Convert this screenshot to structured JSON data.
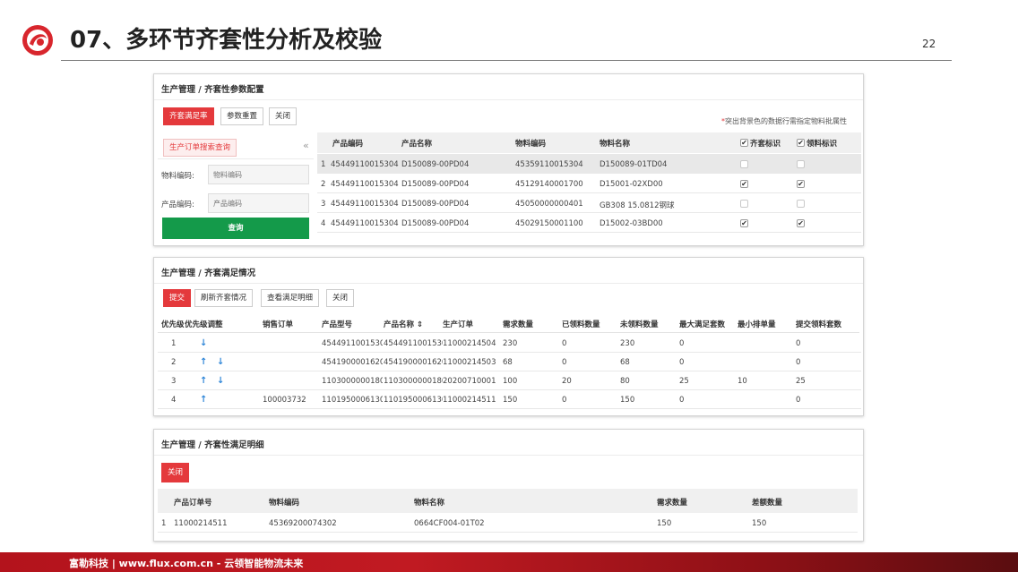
{
  "slide": {
    "title": "07、多环节齐套性分析及校验",
    "page": "22",
    "footer": "富勒科技 | www.flux.com.cn - 云领智能物流未来"
  },
  "colors": {
    "accent_red": "#e4393c",
    "query_green": "#149a4a",
    "arrow_blue": "#2f86d8"
  },
  "panel1": {
    "title": "生产管理 / 齐套性参数配置",
    "buttons": [
      "齐套满足率",
      "参数重置",
      "关闭"
    ],
    "note_star": "*",
    "note": "突出背景色的数据行需指定物料批属性",
    "search_tab": "生产订单搜索查询",
    "collapse": "«",
    "material_label": "物料编码:",
    "material_placeholder": "物料编码",
    "product_label": "产品编码:",
    "product_placeholder": "产品编码",
    "query_btn": "查询",
    "columns": [
      "产品编码",
      "产品名称",
      "物料编码",
      "物料名称",
      "齐套标识",
      "领料标识"
    ],
    "rows": [
      {
        "n": "1",
        "pcode": "45449110015304",
        "pname": "D150089-00PD04",
        "mcode": "45359110015304",
        "mname": "D150089-01TD04",
        "kit": false,
        "pick": false,
        "hl": true
      },
      {
        "n": "2",
        "pcode": "45449110015304",
        "pname": "D150089-00PD04",
        "mcode": "45129140001700",
        "mname": "D15001-02XD00",
        "kit": true,
        "pick": true,
        "hl": false
      },
      {
        "n": "3",
        "pcode": "45449110015304",
        "pname": "D150089-00PD04",
        "mcode": "45050000000401",
        "mname": "GB308 15.0812钢球",
        "kit": false,
        "pick": false,
        "hl": false
      },
      {
        "n": "4",
        "pcode": "45449110015304",
        "pname": "D150089-00PD04",
        "mcode": "45029150001100",
        "mname": "D15002-03BD00",
        "kit": true,
        "pick": true,
        "hl": false
      }
    ]
  },
  "panel2": {
    "title": "生产管理 / 齐套满足情况",
    "buttons": [
      "提交",
      "刷新齐套情况",
      "查看满足明细",
      "关闭"
    ],
    "columns": [
      "优先级",
      "优先级调整",
      "销售订单",
      "产品型号",
      "产品名称 ⇕",
      "生产订单",
      "需求数量",
      "已领料数量",
      "未领料数量",
      "最大满足套数",
      "最小排单量",
      "提交领料套数"
    ],
    "rows": [
      {
        "pri": "1",
        "up": false,
        "down": true,
        "so": "",
        "model": "4544911001530:",
        "name": "4544911001530:",
        "po": "11000214504",
        "req": "230",
        "picked": "0",
        "unpicked": "230",
        "max": "0",
        "min": "",
        "submit": "0"
      },
      {
        "pri": "2",
        "up": true,
        "down": true,
        "so": "",
        "model": "4541900001620:",
        "name": "4541900001620:",
        "po": "11000214503",
        "req": "68",
        "picked": "0",
        "unpicked": "68",
        "max": "0",
        "min": "",
        "submit": "0"
      },
      {
        "pri": "3",
        "up": true,
        "down": true,
        "so": "",
        "model": "1103000000180(",
        "name": "1103000000180(",
        "po": "20200710001",
        "req": "100",
        "picked": "20",
        "unpicked": "80",
        "max": "25",
        "min": "10",
        "submit": "25"
      },
      {
        "pri": "4",
        "up": true,
        "down": false,
        "so": "100003732",
        "model": "1101950006130(",
        "name": "1101950006130(",
        "po": "11000214511",
        "req": "150",
        "picked": "0",
        "unpicked": "150",
        "max": "0",
        "min": "",
        "submit": "0"
      }
    ]
  },
  "panel3": {
    "title": "生产管理 / 齐套性满足明细",
    "button": "关闭",
    "columns": [
      "产品订单号",
      "物料编码",
      "物料名称",
      "需求数量",
      "差额数量"
    ],
    "rows": [
      {
        "n": "1",
        "order": "11000214511",
        "mcode": "45369200074302",
        "mname": "0664CF004-01T02",
        "req": "150",
        "diff": "150"
      }
    ]
  }
}
